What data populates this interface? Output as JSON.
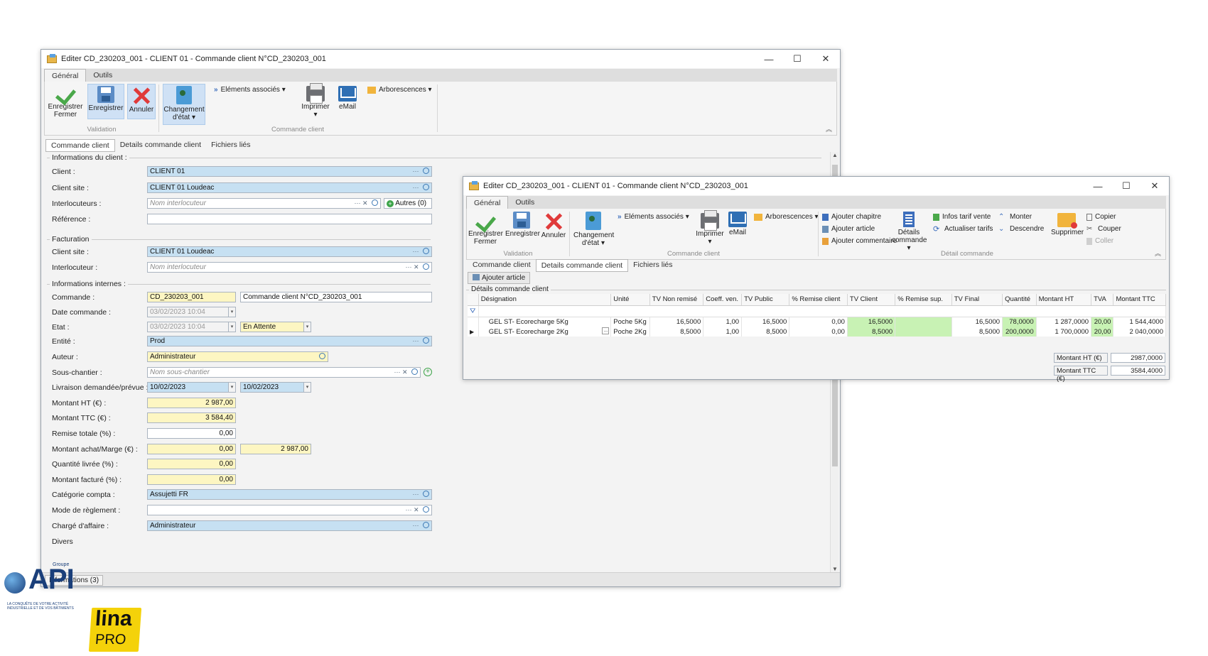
{
  "win1": {
    "title": "Editer CD_230203_001 - CLIENT 01 - Commande client N°CD_230203_001",
    "tabs": [
      "Général",
      "Outils"
    ],
    "ribbon": {
      "save_close": "Enregistrer Fermer",
      "save": "Enregistrer",
      "cancel": "Annuler",
      "change_state": "Changement d'état",
      "related": "Eléments associés",
      "print": "Imprimer",
      "email": "eMail",
      "trees": "Arborescences",
      "group_validation": "Validation",
      "group_order": "Commande client"
    },
    "subtabs": [
      "Commande client",
      "Details commande client",
      "Fichiers liés"
    ],
    "sections": {
      "client_info": "Informations du client :",
      "billing": "Facturation",
      "internal": "Informations internes :",
      "misc": "Divers"
    },
    "fields": {
      "client_label": "Client :",
      "client": "CLIENT 01",
      "client_site_label": "Client site :",
      "client_site": "CLIENT 01 Loudeac",
      "contacts_label": "Interlocuteurs :",
      "contacts_ph": "Nom interlocuteur",
      "others": "Autres (0)",
      "reference_label": "Référence :",
      "reference": "",
      "bill_site_label": "Client site :",
      "bill_site": "CLIENT 01 Loudeac",
      "bill_contact_label": "Interlocuteur :",
      "bill_contact_ph": "Nom interlocuteur",
      "order_label": "Commande :",
      "order_code": "CD_230203_001",
      "order_name": "Commande client N°CD_230203_001",
      "order_date_label": "Date commande :",
      "order_date": "03/02/2023 10:04",
      "state_label": "Etat :",
      "state_date": "03/02/2023 10:04",
      "state": "En Attente",
      "entity_label": "Entité :",
      "entity": "Prod",
      "author_label": "Auteur :",
      "author": "Administrateur",
      "subsite_label": "Sous-chantier :",
      "subsite_ph": "Nom sous-chantier",
      "delivery_label": "Livraison demandée/prévue :",
      "delivery_req": "10/02/2023",
      "delivery_plan": "10/02/2023",
      "amount_ht_label": "Montant HT (€) :",
      "amount_ht": "2 987,00",
      "amount_ttc_label": "Montant TTC (€) :",
      "amount_ttc": "3 584,40",
      "discount_label": "Remise totale (%) :",
      "discount": "0,00",
      "purchase_label": "Montant achat/Marge (€) :",
      "purchase": "0,00",
      "margin": "2 987,00",
      "delivered_label": "Quantité livrée (%) :",
      "delivered": "0,00",
      "invoiced_label": "Montant facturé (%) :",
      "invoiced": "0,00",
      "category_label": "Catégorie compta :",
      "category": "Assujetti FR",
      "payment_label": "Mode de règlement :",
      "payment": "",
      "manager_label": "Chargé d'affaire :",
      "manager": "Administrateur"
    },
    "status": "Informations (3)"
  },
  "win2": {
    "title": "Editer CD_230203_001 - CLIENT 01 - Commande client N°CD_230203_001",
    "tabs": [
      "Général",
      "Outils"
    ],
    "ribbon": {
      "save_close": "Enregistrer Fermer",
      "save": "Enregistrer",
      "cancel": "Annuler",
      "change_state": "Changement d'état",
      "related": "Eléments associés",
      "print": "Imprimer",
      "email": "eMail",
      "trees": "Arborescences",
      "add_chapter": "Ajouter chapitre",
      "add_article": "Ajouter article",
      "add_comment": "Ajouter commentaire",
      "order_details": "Détails commande",
      "price_info": "Infos tarif vente",
      "update_prices": "Actualiser tarifs",
      "up": "Monter",
      "down": "Descendre",
      "delete": "Supprimer",
      "copy": "Copier",
      "cut": "Couper",
      "paste": "Coller",
      "group_validation": "Validation",
      "group_order": "Commande client",
      "group_detail": "Détail commande"
    },
    "subtabs": [
      "Commande client",
      "Details commande client",
      "Fichiers liés"
    ],
    "add_article_btn": "Ajouter article",
    "section": "Détails commande client",
    "columns": [
      "Désignation",
      "Unité",
      "TV Non remisé",
      "Coeff. ven.",
      "TV Public",
      "% Remise client",
      "TV Client",
      "% Remise sup.",
      "TV Final",
      "Quantité",
      "Montant HT",
      "TVA",
      "Montant TTC"
    ],
    "rows": [
      [
        "GEL ST- Ecorecharge 5Kg",
        "Poche 5Kg",
        "16,5000",
        "1,00",
        "16,5000",
        "0,00",
        "16,5000",
        "",
        "16,5000",
        "78,0000",
        "1 287,0000",
        "20,00",
        "1 544,4000"
      ],
      [
        "GEL ST- Ecorecharge 2Kg",
        "Poche 2Kg",
        "8,5000",
        "1,00",
        "8,5000",
        "0,00",
        "8,5000",
        "",
        "8,5000",
        "200,0000",
        "1 700,0000",
        "20,00",
        "2 040,0000"
      ]
    ],
    "totals": {
      "ht_label": "Montant HT (€)",
      "ht": "2987,0000",
      "ttc_label": "Montant TTC (€)",
      "ttc": "3584,4000"
    }
  },
  "logos": {
    "api_top": "Groupe",
    "api": "API",
    "api_tagline": "LA CONQUÊTE DE VOTRE ACTIVITÉ INDUSTRIELLE ET DE VOS BÂTIMENTS",
    "lina": "lina",
    "pro": "PRO"
  },
  "colors": {
    "field_blue": "#c6e0f2",
    "field_yellow": "#fdf6c2",
    "cell_green": "#c8f2b4",
    "accent": "#3b6dbc"
  }
}
